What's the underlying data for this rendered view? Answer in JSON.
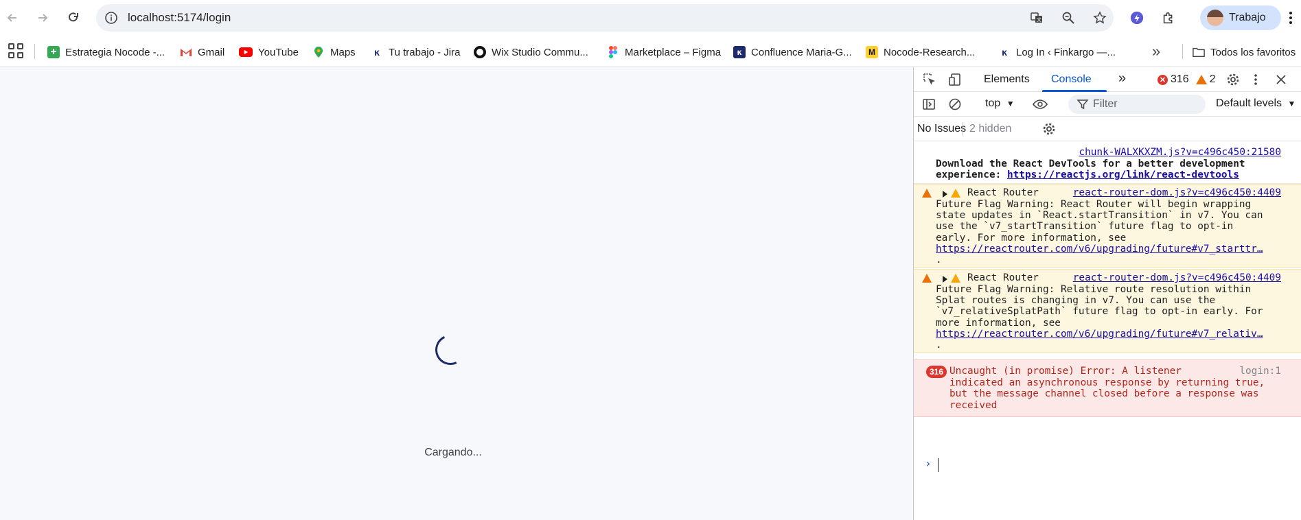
{
  "browser": {
    "url": "localhost:5174/login",
    "profile_name": "Trabajo"
  },
  "bookmarks": [
    {
      "label": "Estrategia Nocode -...",
      "icon": "plus-green-icon",
      "color": "#34a853"
    },
    {
      "label": "Gmail",
      "icon": "gmail-icon",
      "color": "#ea4335"
    },
    {
      "label": "YouTube",
      "icon": "youtube-icon",
      "color": "#ff0000"
    },
    {
      "label": "Maps",
      "icon": "maps-icon",
      "color": "#34a853"
    },
    {
      "label": "Tu trabajo - Jira",
      "icon": "finkargo-icon",
      "color": "#1d2b6b"
    },
    {
      "label": "Wix Studio Commu...",
      "icon": "wix-icon",
      "color": "#111111"
    },
    {
      "label": "Marketplace – Figma",
      "icon": "figma-icon",
      "color": "#f24e1e"
    },
    {
      "label": "Confluence Maria-G...",
      "icon": "confluence-icon",
      "color": "#1d2b6b"
    },
    {
      "label": "Nocode-Research...",
      "icon": "miro-icon",
      "color": "#ffd02f"
    },
    {
      "label": "Log In ‹ Finkargo —...",
      "icon": "finkargo-icon",
      "color": "#1d2b6b"
    }
  ],
  "bookmarks_more": "»",
  "bookmarks_folder": "Todos los favoritos",
  "page": {
    "loading_text": "Cargando..."
  },
  "devtools": {
    "tabs": {
      "elements": "Elements",
      "console": "Console",
      "more": "»"
    },
    "error_count": "316",
    "warning_count": "2",
    "context": "top",
    "filter_placeholder": "Filter",
    "levels": "Default levels",
    "issues": "No Issues",
    "hidden": "2 hidden",
    "messages": {
      "info": {
        "source": "chunk-WALXKXZM.js?v=c496c450:21580",
        "line1": "Download the React DevTools for a better development",
        "line2_prefix": "experience: ",
        "line2_link": "https://reactjs.org/link/react-devtools"
      },
      "warn1": {
        "group": "React Router",
        "source": "react-router-dom.js?v=c496c450:4409",
        "lines": [
          "Future Flag Warning: React Router will begin wrapping",
          "state updates in `React.startTransition` in v7. You can",
          "use the `v7_startTransition` future flag to opt-in",
          "early. For more information, see"
        ],
        "link": "https://reactrouter.com/v6/upgrading/future#v7_starttr…",
        "tail": "."
      },
      "warn2": {
        "group": "React Router",
        "source": "react-router-dom.js?v=c496c450:4409",
        "lines": [
          "Future Flag Warning: Relative route resolution within",
          "Splat routes is changing in v7. You can use the",
          "`v7_relativeSplatPath` future flag to opt-in early. For",
          "more information, see"
        ],
        "link": "https://reactrouter.com/v6/upgrading/future#v7_relativ…",
        "tail": "."
      },
      "error": {
        "count": "316",
        "source": "login:1",
        "lines": [
          "Uncaught (in promise) Error: A listener",
          "indicated an asynchronous response by returning true,",
          "but the message channel closed before a response was",
          "received"
        ]
      }
    },
    "prompt": "›"
  }
}
